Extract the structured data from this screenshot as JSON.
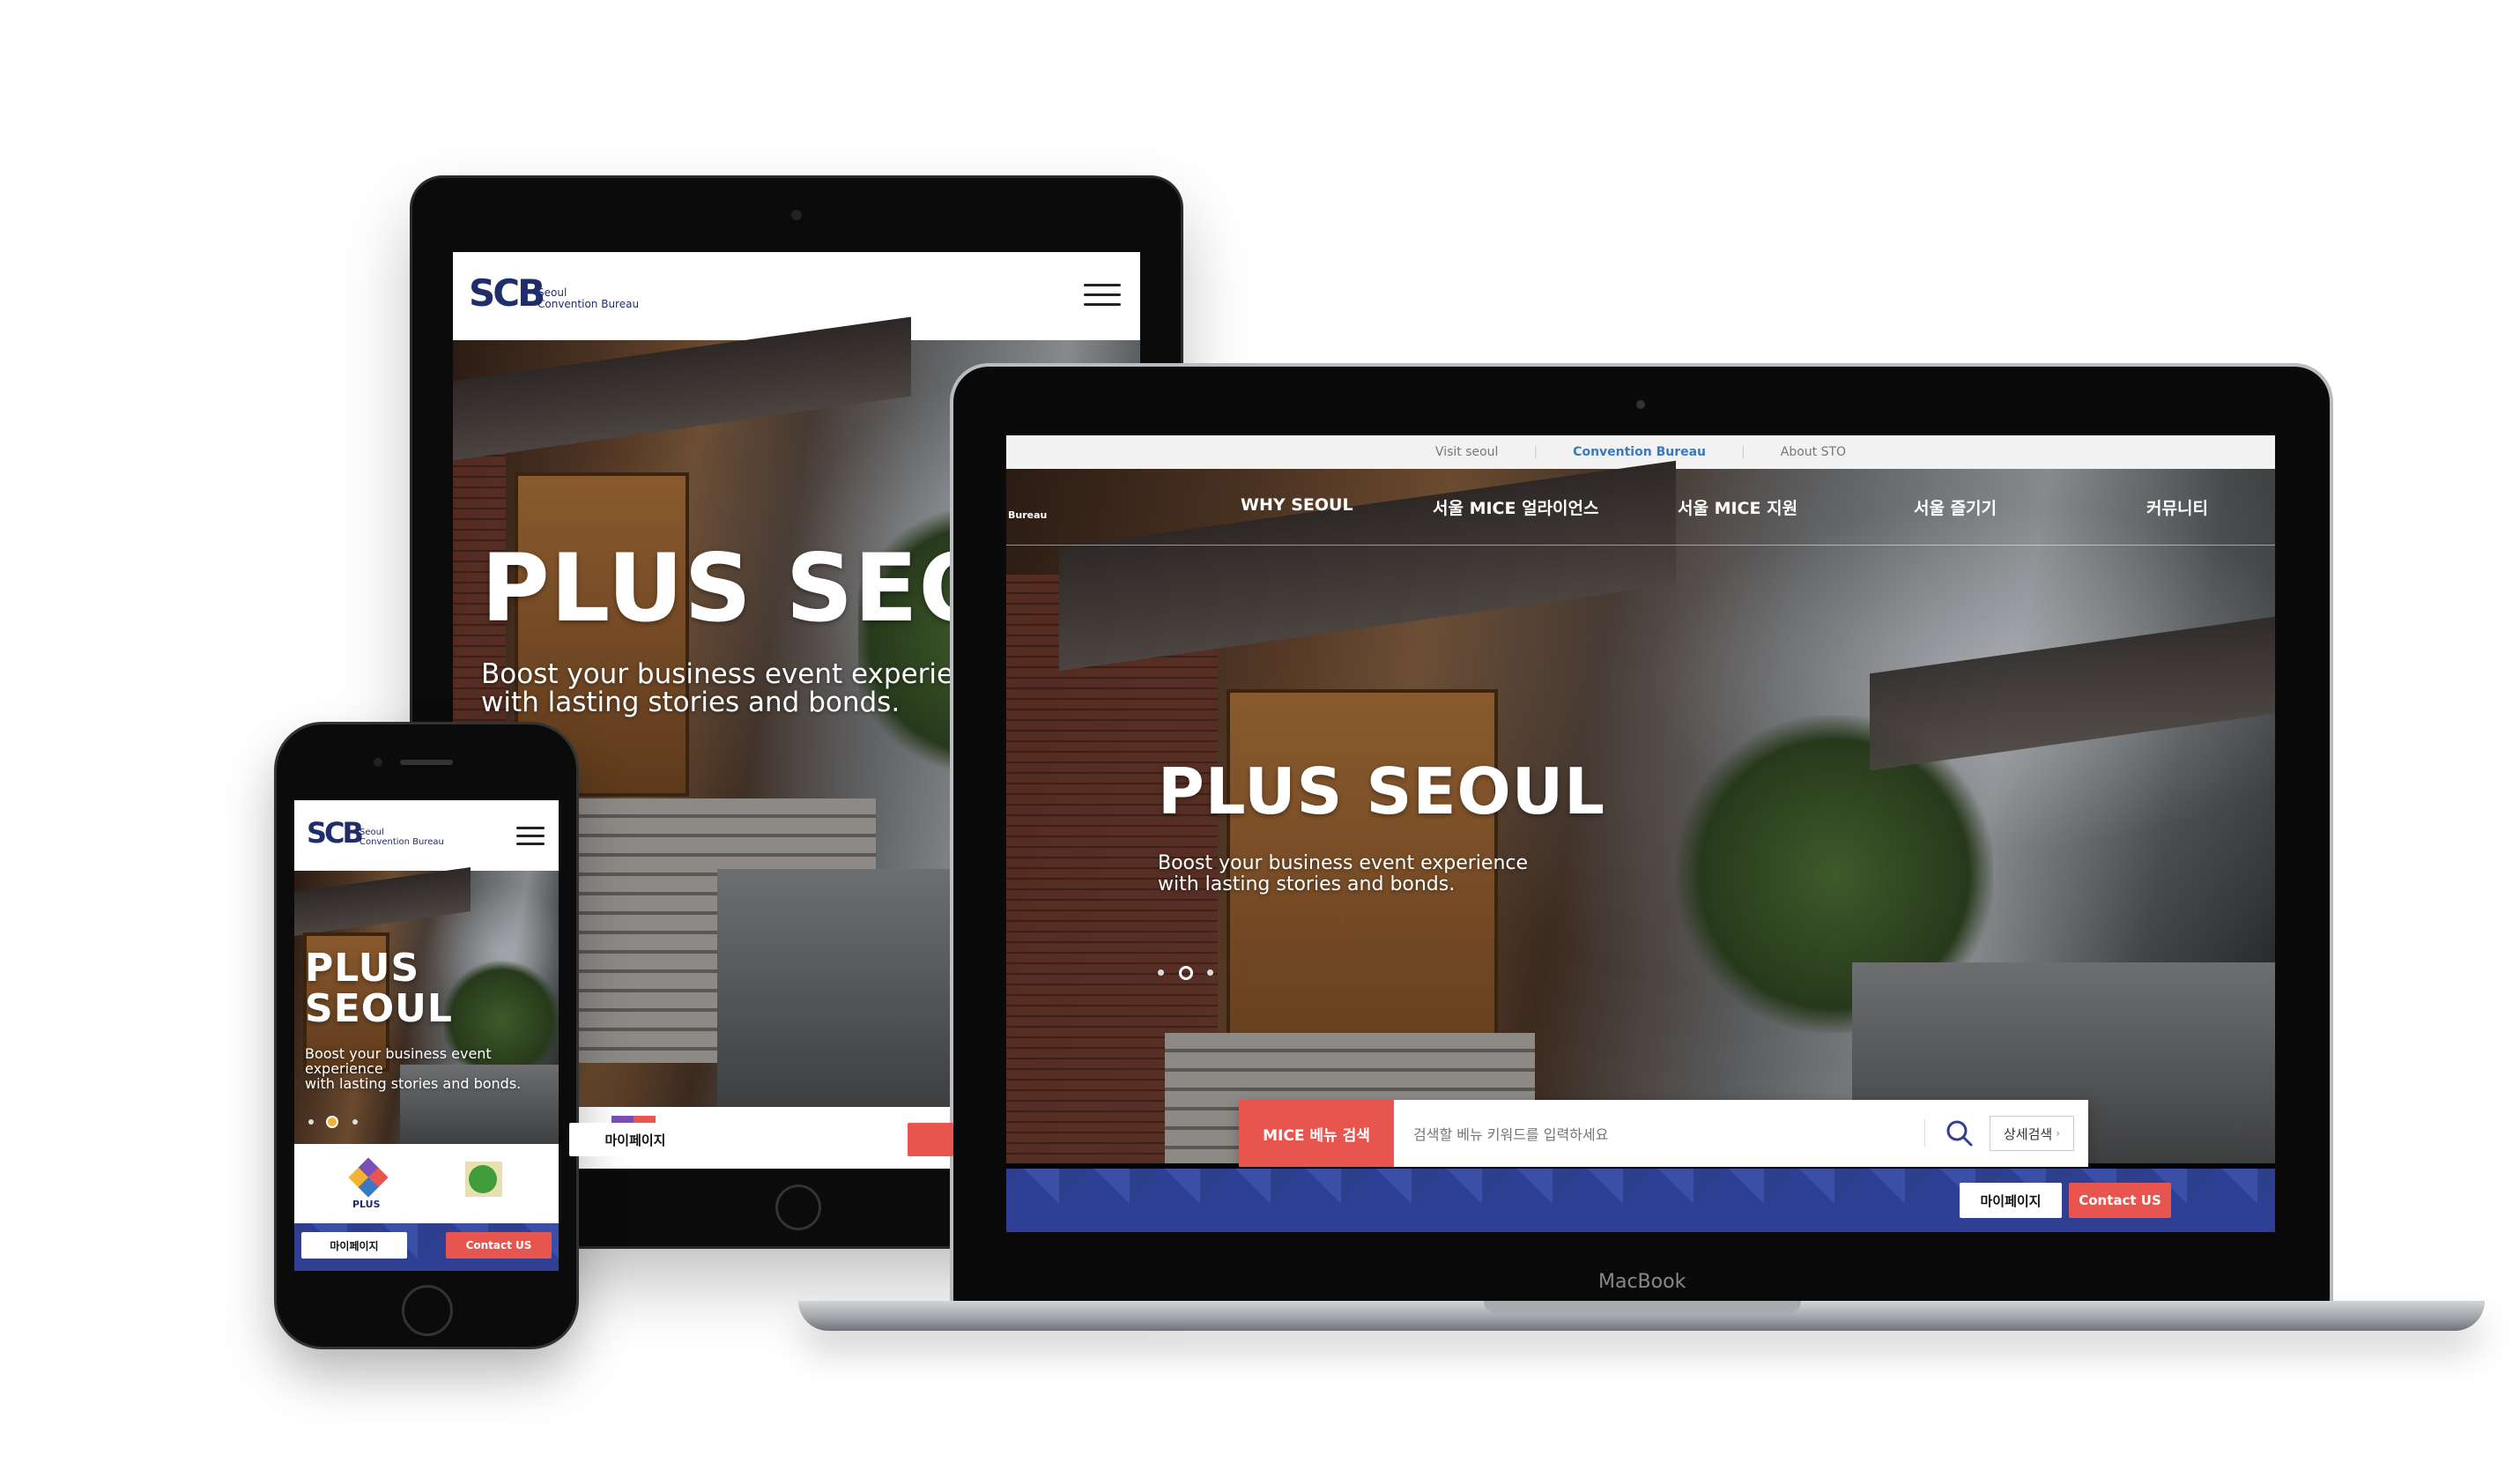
{
  "brand": {
    "logo": "SCB",
    "logo_line1": "Seoul",
    "logo_line2": "Convention Bureau",
    "nav_partial": "Bureau"
  },
  "laptop": {
    "model_label": "MacBook",
    "top_bar": [
      "Visit seoul",
      "Convention Bureau",
      "About STO"
    ],
    "top_bar_active": "Convention Bureau",
    "nav": [
      "WHY SEOUL",
      "서울 MICE 얼라이언스",
      "서울 MICE 지원",
      "서울 즐기기",
      "커뮤니티"
    ],
    "hero_title": "PLUS SEOUL",
    "hero_sub_1": "Boost your business event experience",
    "hero_sub_2": "with lasting stories and bonds.",
    "search_label": "MICE 베뉴 검색",
    "search_placeholder": "검색할 베뉴 키워드를 입력하세요",
    "detail_search": "상세검색",
    "mypage": "마이페이지",
    "contact": "Contact US"
  },
  "tablet": {
    "hero_title": "PLUS SEOUL",
    "hero_sub_1": "Boost your business event experience",
    "hero_sub_2": "with lasting stories and bonds.",
    "mypage": "마이페이지"
  },
  "phone": {
    "hero_title_1": "PLUS",
    "hero_title_2": "SEOUL",
    "hero_sub_1": "Boost your business event",
    "hero_sub_2": "experience",
    "hero_sub_3": "with lasting stories and bonds.",
    "plus_logo_label": "PLUS",
    "mypage": "마이페이지",
    "contact": "Contact US"
  },
  "colors": {
    "brand_navy": "#1f2d6b",
    "accent_red": "#e8554f",
    "pattern_blue": "#2f3f94",
    "active_link_blue": "#3a78c2"
  }
}
